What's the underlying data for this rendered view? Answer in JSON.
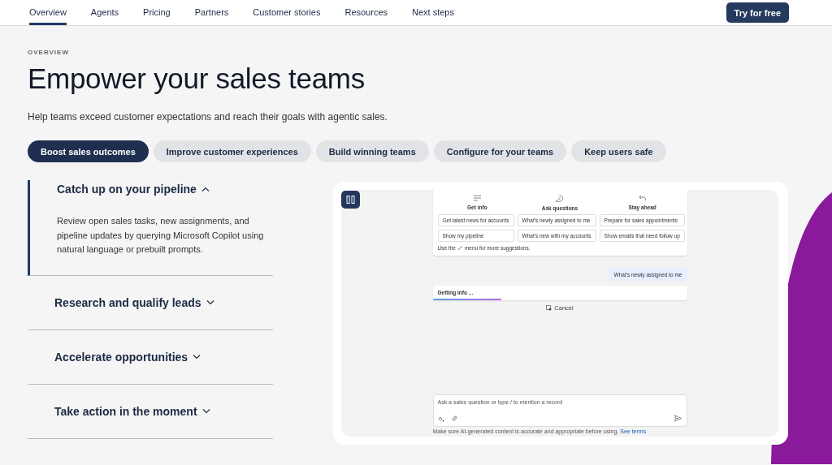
{
  "nav": {
    "links": [
      {
        "label": "Overview",
        "selected": true
      },
      {
        "label": "Agents",
        "selected": false
      },
      {
        "label": "Pricing",
        "selected": false
      },
      {
        "label": "Partners",
        "selected": false
      },
      {
        "label": "Customer stories",
        "selected": false
      },
      {
        "label": "Resources",
        "selected": false
      },
      {
        "label": "Next steps",
        "selected": false
      }
    ],
    "cta": "Try for free"
  },
  "hero": {
    "eyebrow": "OVERVIEW",
    "title": "Empower your sales teams",
    "subtitle": "Help teams exceed customer expectations and reach their goals with agentic sales."
  },
  "tabs": [
    {
      "label": "Boost sales outcomes",
      "selected": true
    },
    {
      "label": "Improve customer experiences",
      "selected": false
    },
    {
      "label": "Build winning teams",
      "selected": false
    },
    {
      "label": "Configure for your teams",
      "selected": false
    },
    {
      "label": "Keep users safe",
      "selected": false
    }
  ],
  "accordion": [
    {
      "title": "Catch up on your pipeline",
      "expanded": true,
      "body": "Review open sales tasks, new assignments, and pipeline updates by querying Microsoft Copilot using natural language or prebuilt prompts."
    },
    {
      "title": "Research and qualify leads",
      "expanded": false
    },
    {
      "title": "Accelerate opportunities",
      "expanded": false
    },
    {
      "title": "Take action in the moment",
      "expanded": false
    }
  ],
  "demo": {
    "columns": [
      "Get info",
      "Ask questions",
      "Stay ahead"
    ],
    "suggestions": [
      [
        "Get latest news for accounts",
        "What's newly assigned to me",
        "Prepare for sales appointments"
      ],
      [
        "Show my pipeline",
        "What's new with my accounts",
        "Show emails that need follow up"
      ]
    ],
    "hint_before": "Use the",
    "hint_after": "menu for more suggestions.",
    "user_message": "What's newly assigned to me",
    "status": "Getting info ...",
    "level": 0.27,
    "cancel": "Cancel",
    "input_placeholder": "Ask a sales question or type / to mention a record",
    "disclaimer": "Make sure AI-generated content is accurate and appropriate before using.",
    "disclaimer_link": "See terms"
  }
}
